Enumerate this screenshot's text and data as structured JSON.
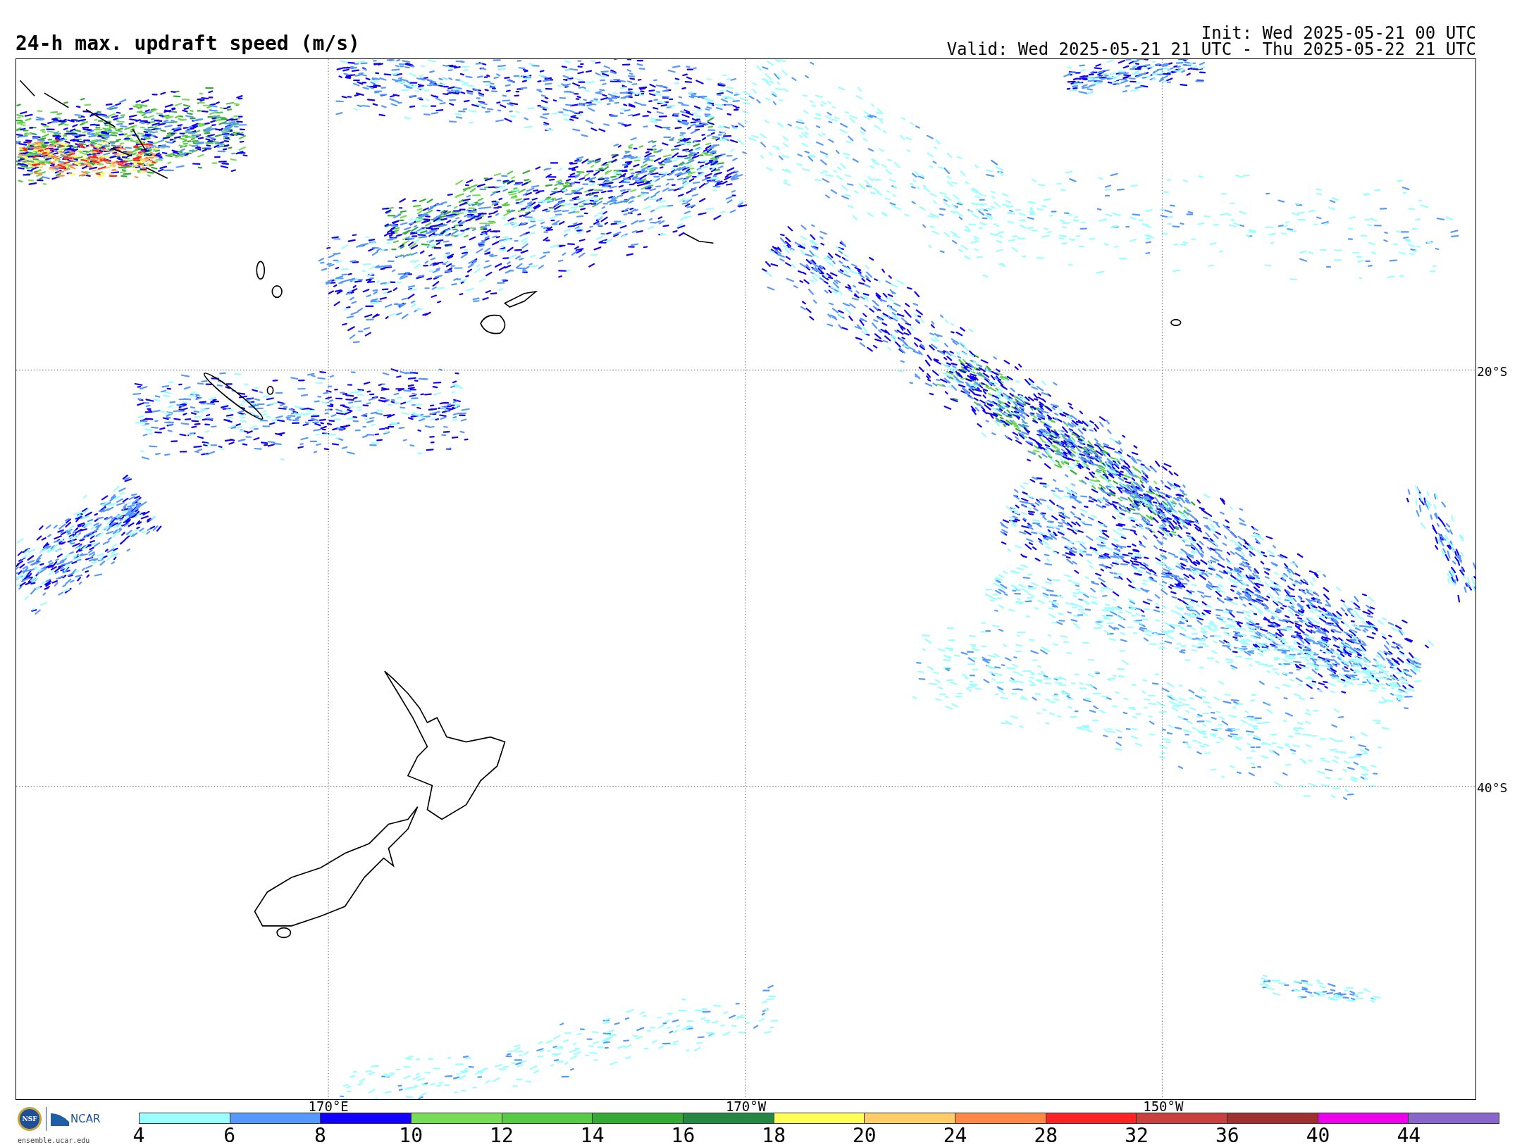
{
  "title": "24-h max. updraft speed (m/s)",
  "init": "Init: Wed 2025-05-21 00 UTC",
  "valid": "Valid: Wed 2025-05-21 21 UTC - Thu 2025-05-22 21 UTC",
  "map": {
    "lat_labels": [
      "20°S",
      "40°S"
    ],
    "lon_labels": [
      "170°E",
      "170°W",
      "150°W"
    ]
  },
  "logo": {
    "seal_text": "NSF",
    "name": "NCAR",
    "url": "ensemble.ucar.edu"
  },
  "legend": {
    "segments": [
      {
        "label": "4",
        "color": "#99ffff"
      },
      {
        "label": "6",
        "color": "#5599ff"
      },
      {
        "label": "8",
        "color": "#1100ff"
      },
      {
        "label": "10",
        "color": "#77dd55"
      },
      {
        "label": "12",
        "color": "#55cc44"
      },
      {
        "label": "14",
        "color": "#33aa33"
      },
      {
        "label": "16",
        "color": "#228844"
      },
      {
        "label": "18",
        "color": "#ffff55"
      },
      {
        "label": "20",
        "color": "#ffcc66"
      },
      {
        "label": "24",
        "color": "#ff8844"
      },
      {
        "label": "28",
        "color": "#ff2222"
      },
      {
        "label": "32",
        "color": "#cc3f3f"
      },
      {
        "label": "36",
        "color": "#a03030"
      },
      {
        "label": "40",
        "color": "#ee00ee"
      },
      {
        "label": "44",
        "color": "#8866cc"
      }
    ]
  }
}
